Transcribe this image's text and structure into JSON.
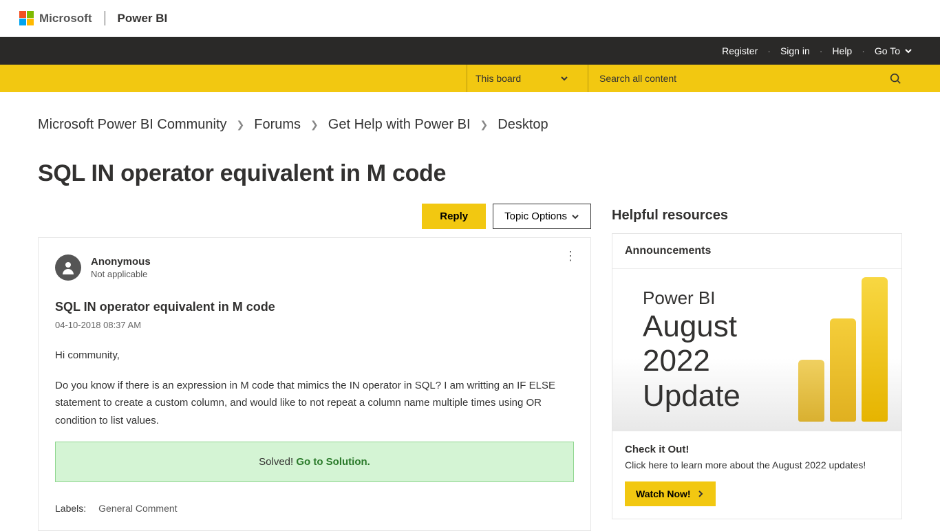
{
  "brand": {
    "microsoft": "Microsoft",
    "product": "Power BI"
  },
  "topnav": {
    "register": "Register",
    "signin": "Sign in",
    "help": "Help",
    "goto": "Go To"
  },
  "search": {
    "scope": "This board",
    "placeholder": "Search all content"
  },
  "breadcrumbs": [
    "Microsoft Power BI Community",
    "Forums",
    "Get Help with Power BI",
    "Desktop"
  ],
  "page_title": "SQL IN operator equivalent in M code",
  "actions": {
    "reply": "Reply",
    "topic_options": "Topic Options"
  },
  "post": {
    "author": "Anonymous",
    "role": "Not applicable",
    "subject": "SQL IN operator equivalent in M code",
    "date": "04-10-2018 08:37 AM",
    "greeting": "Hi community,",
    "body": "Do you know if there is an expression in M code that mimics the IN operator in SQL? I am writting an IF ELSE statement to create a custom column, and would like to not repeat a column name multiple times using OR condition to list values.",
    "solved_prefix": "Solved! ",
    "solved_link": "Go to Solution.",
    "labels_label": "Labels:",
    "labels": [
      "General Comment"
    ]
  },
  "sidebar": {
    "heading": "Helpful resources",
    "announcements_label": "Announcements",
    "hero": {
      "line1": "Power BI",
      "line2": "August",
      "line3": "2022",
      "line4": "Update"
    },
    "card_title": "Check it Out!",
    "card_text": "Click here to learn more about the August 2022 updates!",
    "watch": "Watch Now!"
  }
}
